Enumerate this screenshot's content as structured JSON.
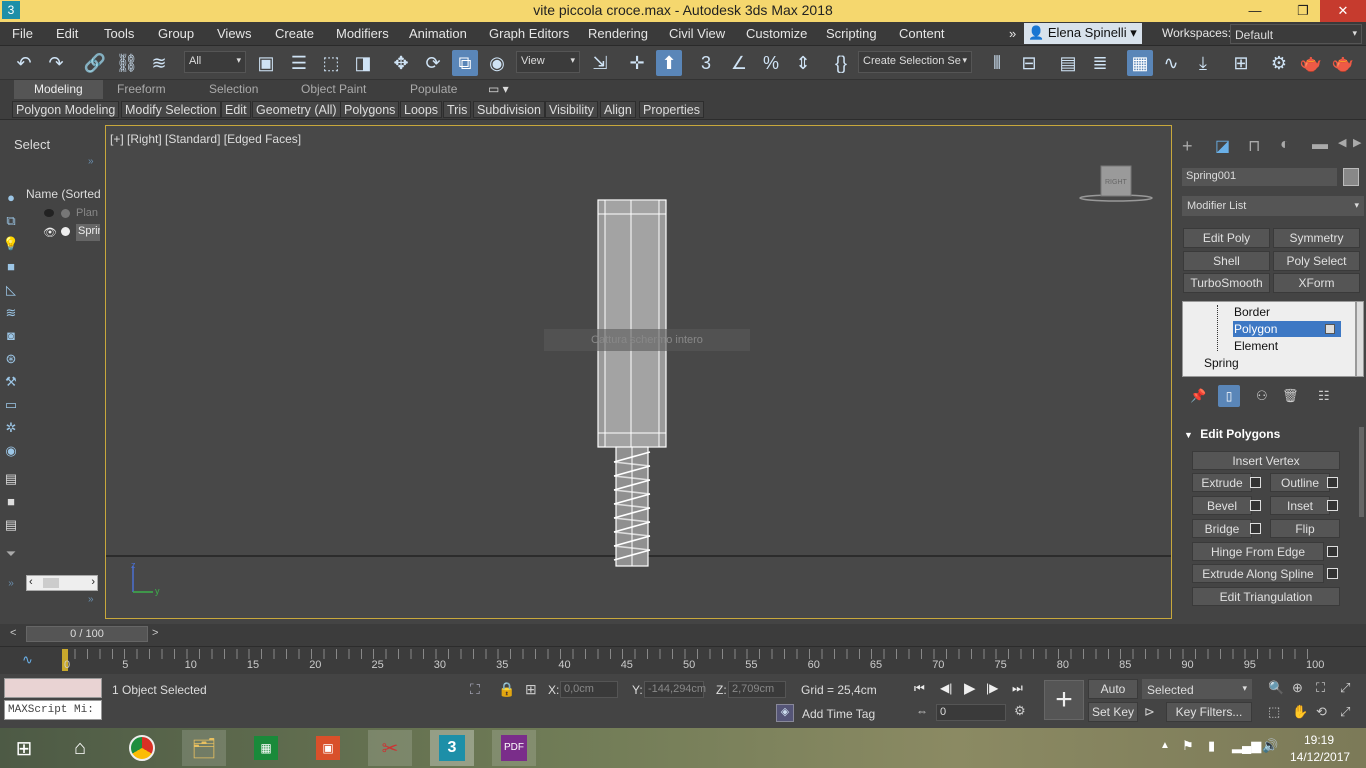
{
  "window": {
    "title": "vite piccola croce.max - Autodesk 3ds Max 2018",
    "minimize": "—",
    "restore": "❐",
    "close": "✕"
  },
  "menu": [
    "File",
    "Edit",
    "Tools",
    "Group",
    "Views",
    "Create",
    "Modifiers",
    "Animation",
    "Graph Editors",
    "Rendering",
    "Civil View",
    "Customize",
    "Scripting",
    "Content"
  ],
  "user": {
    "name": "Elena Spinelli",
    "workspaces_label": "Workspaces:",
    "workspace": "Default"
  },
  "toolbar": {
    "filter": "All",
    "ref_coord": "View",
    "selection_set": "Create Selection Se"
  },
  "ribbon": {
    "tabs": [
      "Modeling",
      "Freeform",
      "Selection",
      "Object Paint",
      "Populate"
    ],
    "panels": [
      "Polygon Modeling",
      "Modify Selection",
      "Edit",
      "Geometry (All)",
      "Polygons",
      "Loops",
      "Tris",
      "Subdivision",
      "Visibility",
      "Align",
      "Properties"
    ]
  },
  "explorer": {
    "select_label": "Select",
    "column": "Name (Sorted A",
    "items": [
      "Plan",
      "Sprir"
    ]
  },
  "viewport": {
    "label": "[+] [Right] [Standard] [Edged Faces]",
    "overlay_text": "Cattura schermo intero",
    "viewcube": "RIGHT",
    "axis_z": "z",
    "axis_y": "y"
  },
  "command_panel": {
    "object_name": "Spring001",
    "modifier_list": "Modifier List",
    "modifier_buttons": [
      "Edit Poly",
      "Symmetry",
      "Shell",
      "Poly Select",
      "TurboSmooth",
      "XForm"
    ],
    "stack": [
      "Border",
      "Polygon",
      "Element",
      "Spring"
    ],
    "rollout_title": "Edit Polygons",
    "insert_vertex": "Insert Vertex",
    "ops": [
      "Extrude",
      "Outline",
      "Bevel",
      "Inset",
      "Bridge",
      "Flip"
    ],
    "hinge": "Hinge From Edge",
    "extrude_spline": "Extrude Along Spline",
    "edit_tri": "Edit Triangulation"
  },
  "timeline": {
    "frame": "0 / 100",
    "ticks": [
      "0",
      "5",
      "10",
      "15",
      "20",
      "25",
      "30",
      "35",
      "40",
      "45",
      "50",
      "55",
      "60",
      "65",
      "70",
      "75",
      "80",
      "85",
      "90",
      "95",
      "100"
    ]
  },
  "status": {
    "maxscript": "MAXScript Mi:",
    "selected": "1 Object Selected",
    "x_label": "X:",
    "x": "0,0cm",
    "y_label": "Y:",
    "y": "-144,294cm",
    "z_label": "Z:",
    "z": "2,709cm",
    "grid": "Grid = 25,4cm",
    "add_time_tag": "Add Time Tag",
    "auto_key": "Auto Key",
    "set_key": "Set Key",
    "key_mode": "Selected",
    "key_filters": "Key Filters...",
    "frame_field": "0"
  },
  "taskbar": {
    "time": "19:19",
    "date": "14/12/2017"
  }
}
